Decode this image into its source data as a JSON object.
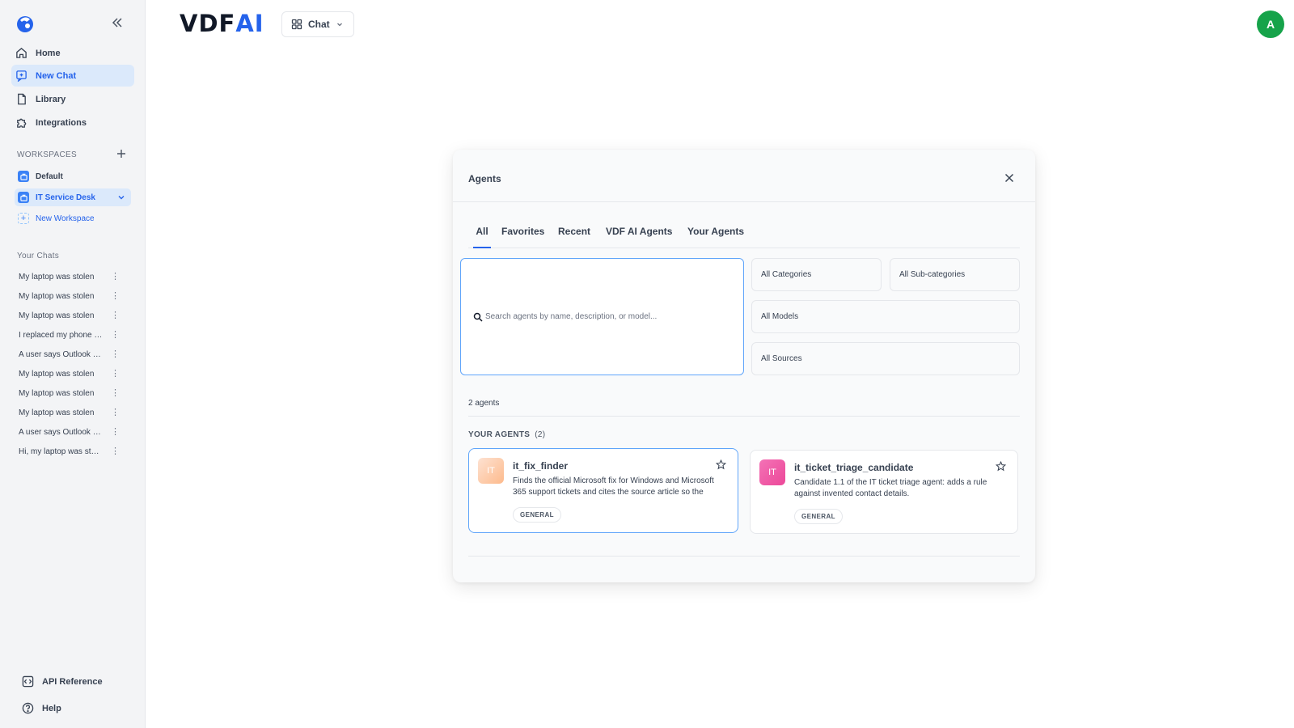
{
  "brand": {
    "part1": "VDF",
    "part2": "AI"
  },
  "header": {
    "chat_button": "Chat",
    "avatar_initial": "A"
  },
  "sidebar": {
    "nav": [
      {
        "label": "Home",
        "icon": "home-icon"
      },
      {
        "label": "New Chat",
        "icon": "new-chat-icon",
        "active": true
      },
      {
        "label": "Library",
        "icon": "file-icon"
      },
      {
        "label": "Integrations",
        "icon": "puzzle-icon"
      }
    ],
    "workspaces_label": "WORKSPACES",
    "workspaces": [
      {
        "label": "Default"
      },
      {
        "label": "IT Service Desk",
        "active": true
      }
    ],
    "new_workspace": "New Workspace",
    "chats_label": "Your Chats",
    "chats": [
      "My laptop was stolen",
      "My laptop was stolen",
      "My laptop was stolen",
      "I replaced my phone and",
      "A user says Outlook keeps",
      "My laptop was stolen",
      "My laptop was stolen",
      "My laptop was stolen",
      "A user says Outlook keeps",
      "Hi, my laptop was stolen"
    ],
    "bottom": [
      {
        "label": "API Reference",
        "icon": "code-icon"
      },
      {
        "label": "Help",
        "icon": "help-icon"
      }
    ]
  },
  "modal": {
    "title": "Agents",
    "tabs": [
      "All",
      "Favorites",
      "Recent",
      "VDF AI Agents",
      "Your Agents"
    ],
    "search_placeholder": "Search agents by name, description, or model...",
    "filters": {
      "categories": "All Categories",
      "subcategories": "All Sub-categories",
      "models": "All Models",
      "sources": "All Sources"
    },
    "count": "2 agents",
    "your_agents_label": "YOUR AGENTS",
    "your_agents_count": "(2)",
    "agents": [
      {
        "initials": "IT",
        "name": "it_fix_finder",
        "description": "Finds the official Microsoft fix for Windows and Microsoft 365 support tickets and cites the source article so the agent can resolve it.",
        "badge": "GENERAL"
      },
      {
        "initials": "IT",
        "name": "it_ticket_triage_candidate",
        "description": "Candidate 1.1 of the IT ticket triage agent: adds a rule against invented contact details.",
        "badge": "GENERAL"
      }
    ]
  },
  "colors": {
    "accent": "#2563eb",
    "active_bg": "#dbe9fb",
    "avatar": "#16a34a"
  }
}
